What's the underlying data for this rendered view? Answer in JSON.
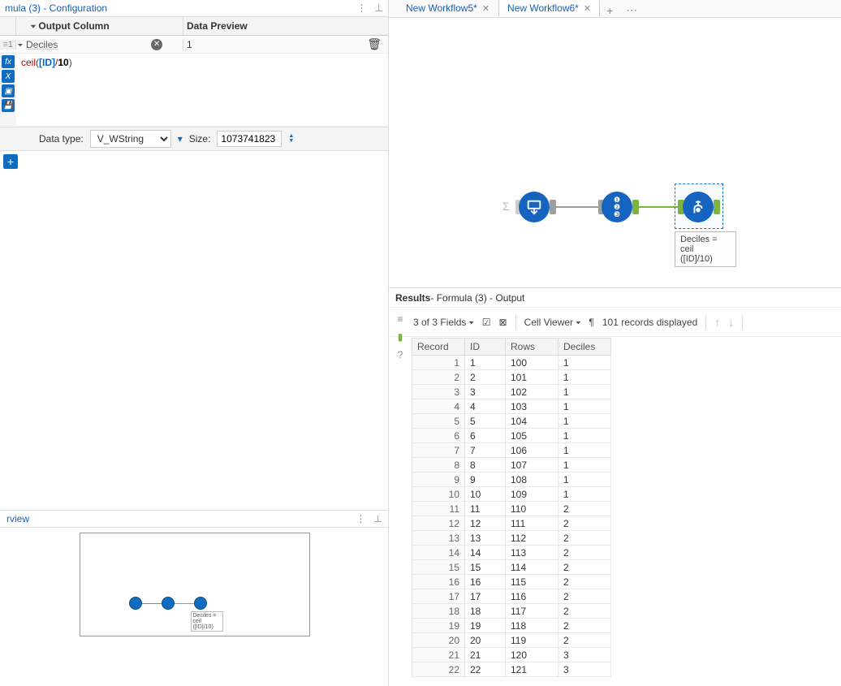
{
  "config": {
    "title": "mula (3) - Configuration",
    "headers": {
      "output": "Output Column",
      "preview": "Data Preview"
    },
    "row_index": "1",
    "output_field": "Deciles",
    "preview_value": "1",
    "expression_html": "<span class='tok-fn'>ceil</span><span class='tok-bk'>(</span><span class='tok-fld'>[ID]</span><span class='tok-op'>/</span><span class='tok-num'>10</span><span class='tok-bk'>)</span>",
    "data_type_label": "Data type:",
    "data_type_value": "V_WString",
    "size_label": "Size:",
    "size_value": "1073741823"
  },
  "overview": {
    "title": "rview",
    "annotation": "Deciles = ceil\n([ID]/10)"
  },
  "tabs": [
    {
      "label": "New Workflow5*",
      "active": false
    },
    {
      "label": "New Workflow6*",
      "active": true
    }
  ],
  "canvas": {
    "annotation": "Deciles = ceil\n([ID]/10)"
  },
  "results": {
    "title_bold": "Results",
    "title_rest": " - Formula (3) - Output",
    "fields_text": "3 of 3 Fields",
    "cell_viewer": "Cell Viewer",
    "records_text": "101 records displayed",
    "columns": [
      "Record",
      "ID",
      "Rows",
      "Deciles"
    ],
    "rows": [
      [
        1,
        1,
        100,
        1
      ],
      [
        2,
        2,
        101,
        1
      ],
      [
        3,
        3,
        102,
        1
      ],
      [
        4,
        4,
        103,
        1
      ],
      [
        5,
        5,
        104,
        1
      ],
      [
        6,
        6,
        105,
        1
      ],
      [
        7,
        7,
        106,
        1
      ],
      [
        8,
        8,
        107,
        1
      ],
      [
        9,
        9,
        108,
        1
      ],
      [
        10,
        10,
        109,
        1
      ],
      [
        11,
        11,
        110,
        2
      ],
      [
        12,
        12,
        111,
        2
      ],
      [
        13,
        13,
        112,
        2
      ],
      [
        14,
        14,
        113,
        2
      ],
      [
        15,
        15,
        114,
        2
      ],
      [
        16,
        16,
        115,
        2
      ],
      [
        17,
        17,
        116,
        2
      ],
      [
        18,
        18,
        117,
        2
      ],
      [
        19,
        19,
        118,
        2
      ],
      [
        20,
        20,
        119,
        2
      ],
      [
        21,
        21,
        120,
        3
      ],
      [
        22,
        22,
        121,
        3
      ]
    ]
  }
}
